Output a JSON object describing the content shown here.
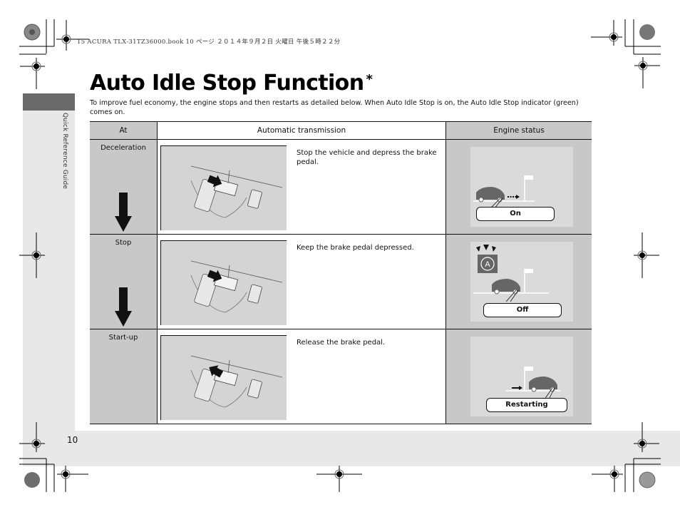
{
  "header_stamp": "15 ACURA TLX-31TZ36000.book  10 ページ  ２０１４年９月２日  火曜日  午後５時２２分",
  "side_label": "Quick Reference Guide",
  "page_title": "Auto Idle Stop Function",
  "title_marker": "*",
  "intro_text": "To improve fuel economy, the engine stops and then restarts as detailed below. When Auto Idle Stop is on, the Auto Idle Stop indicator (green) comes on.",
  "table": {
    "headers": {
      "at": "At",
      "transmission": "Automatic transmission",
      "engine": "Engine status"
    },
    "rows": [
      {
        "at": "Deceleration",
        "instruction": "Stop the vehicle and depress the brake pedal.",
        "pedal_arrow": "push",
        "engine_status": "On",
        "indicator": false
      },
      {
        "at": "Stop",
        "instruction": "Keep the brake pedal depressed.",
        "pedal_arrow": "push",
        "engine_status": "Off",
        "indicator": true
      },
      {
        "at": "Start-up",
        "instruction": "Release the brake pedal.",
        "pedal_arrow": "release",
        "engine_status": "Restarting",
        "indicator": false
      }
    ]
  },
  "indicator_glyph": "A",
  "page_number": "10",
  "colors": {
    "band": "#e8e8e8",
    "tab": "#6a6a6a",
    "cell_gray": "#c8c8c8",
    "car": "#666666"
  }
}
